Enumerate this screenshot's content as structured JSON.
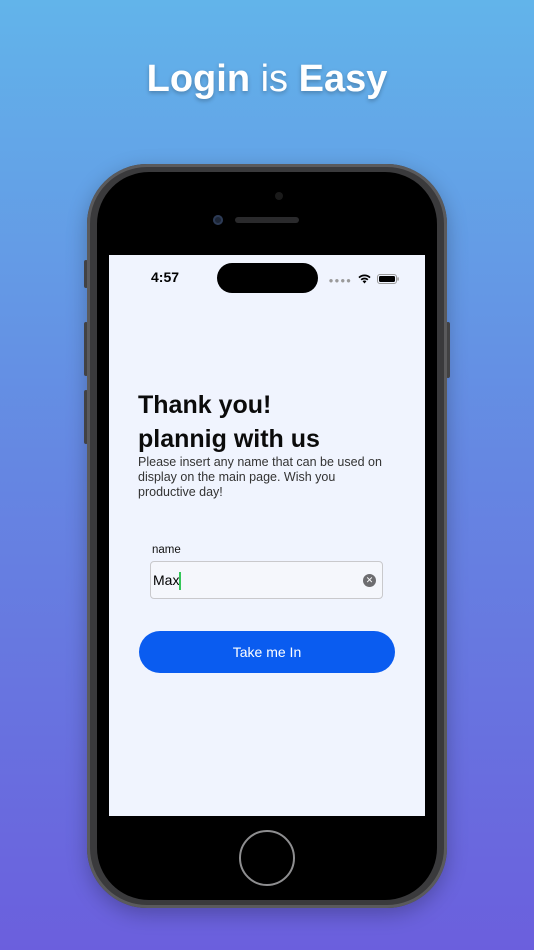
{
  "promo": {
    "word1": "Login",
    "word2": "is",
    "word3": "Easy"
  },
  "status_bar": {
    "time": "4:57",
    "signal_icon": "cellular-dots-icon",
    "wifi_icon": "wifi-icon",
    "battery_icon": "battery-icon"
  },
  "screen": {
    "heading": "Thank you!\nplannig with us",
    "description": "Please insert any name that can be used on display on the main page. Wish you productive day!",
    "field_label": "name",
    "name_value": "Max",
    "clear_icon": "clear-circle-icon",
    "button_label": "Take me In"
  },
  "colors": {
    "accent": "#0a5cf0",
    "background_top": "#62b4ea",
    "background_bottom": "#6b5fdd",
    "screen_bg": "#f0f4fe",
    "caret": "#34c759"
  }
}
